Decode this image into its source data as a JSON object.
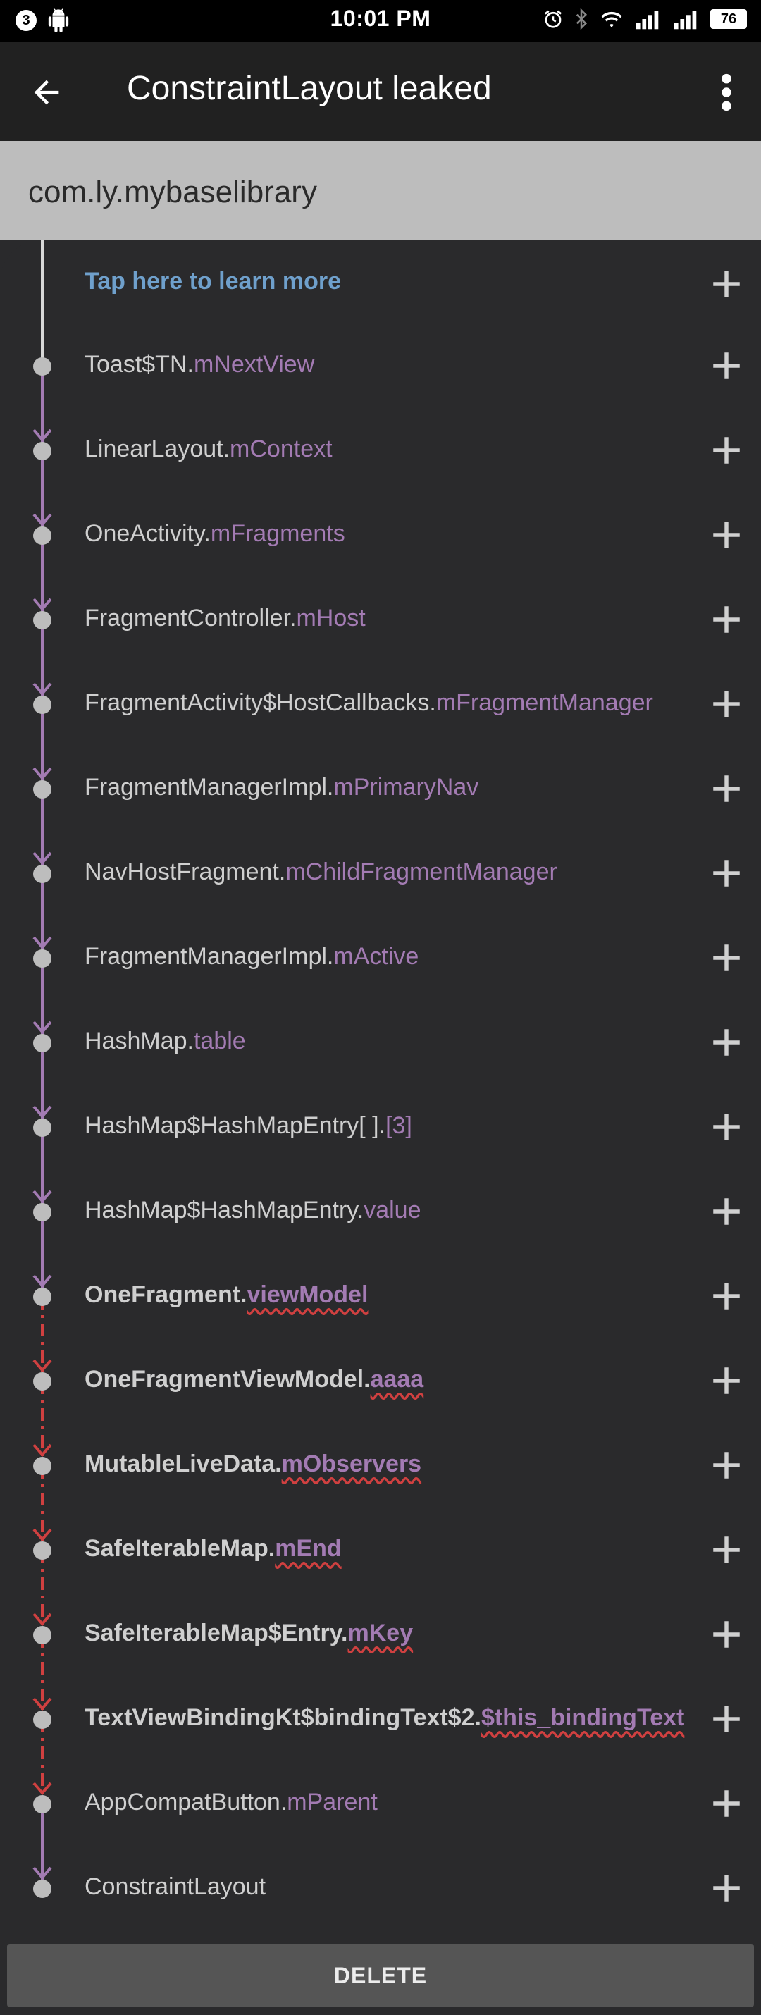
{
  "status_bar": {
    "notification_count": "3",
    "time": "10:01 PM",
    "battery": "76"
  },
  "toolbar": {
    "title": "ConstraintLayout leaked"
  },
  "header": {
    "app_package": "com.ly.mybaselibrary"
  },
  "learn_more": "Tap here to learn more",
  "trace": [
    {
      "cls": "Toast$TN.",
      "field": "mNextView",
      "bold": false,
      "edge": "solid"
    },
    {
      "cls": "LinearLayout.",
      "field": "mContext",
      "bold": false,
      "edge": "solid"
    },
    {
      "cls": "OneActivity.",
      "field": "mFragments",
      "bold": false,
      "edge": "solid"
    },
    {
      "cls": "FragmentController.",
      "field": "mHost",
      "bold": false,
      "edge": "solid"
    },
    {
      "cls": "FragmentActivity$HostCallbacks.",
      "field": "mFragmentManager",
      "bold": false,
      "edge": "solid"
    },
    {
      "cls": "FragmentManagerImpl.",
      "field": "mPrimaryNav",
      "bold": false,
      "edge": "solid"
    },
    {
      "cls": "NavHostFragment.",
      "field": "mChildFragmentManager",
      "bold": false,
      "edge": "solid"
    },
    {
      "cls": "FragmentManagerImpl.",
      "field": "mActive",
      "bold": false,
      "edge": "solid"
    },
    {
      "cls": "HashMap.",
      "field": "table",
      "bold": false,
      "edge": "solid"
    },
    {
      "cls": "HashMap$HashMapEntry[ ].",
      "field": "[3]",
      "bold": false,
      "edge": "solid"
    },
    {
      "cls": "HashMap$HashMapEntry.",
      "field": "value",
      "bold": false,
      "edge": "solid"
    },
    {
      "cls": "OneFragment.",
      "field": "viewModel",
      "bold": true,
      "edge": "dashed"
    },
    {
      "cls": "OneFragmentViewModel.",
      "field": "aaaa",
      "bold": true,
      "edge": "dashed"
    },
    {
      "cls": "MutableLiveData.",
      "field": "mObservers",
      "bold": true,
      "edge": "dashed"
    },
    {
      "cls": "SafeIterableMap.",
      "field": "mEnd",
      "bold": true,
      "edge": "dashed"
    },
    {
      "cls": "SafeIterableMap$Entry.",
      "field": "mKey",
      "bold": true,
      "edge": "dashed"
    },
    {
      "cls": "TextViewBindingKt$bindingText$2.",
      "field": "$this_bindingText",
      "bold": true,
      "edge": "dashed"
    },
    {
      "cls": "AppCompatButton.",
      "field": "mParent",
      "bold": false,
      "edge": "solid"
    },
    {
      "cls": "ConstraintLayout",
      "field": "",
      "bold": false,
      "edge": "none"
    }
  ],
  "delete_label": "DELETE",
  "colors": {
    "solid_edge": "#a37bb3",
    "dashed_edge": "#d04040",
    "node": "#bdbdbd",
    "learn_link": "#6fa0cc"
  },
  "icons": [
    "back-arrow-icon",
    "more-vert-icon",
    "plus-icon",
    "alarm-icon",
    "bluetooth-icon",
    "wifi-icon",
    "signal-icon",
    "battery-icon",
    "android-icon"
  ]
}
